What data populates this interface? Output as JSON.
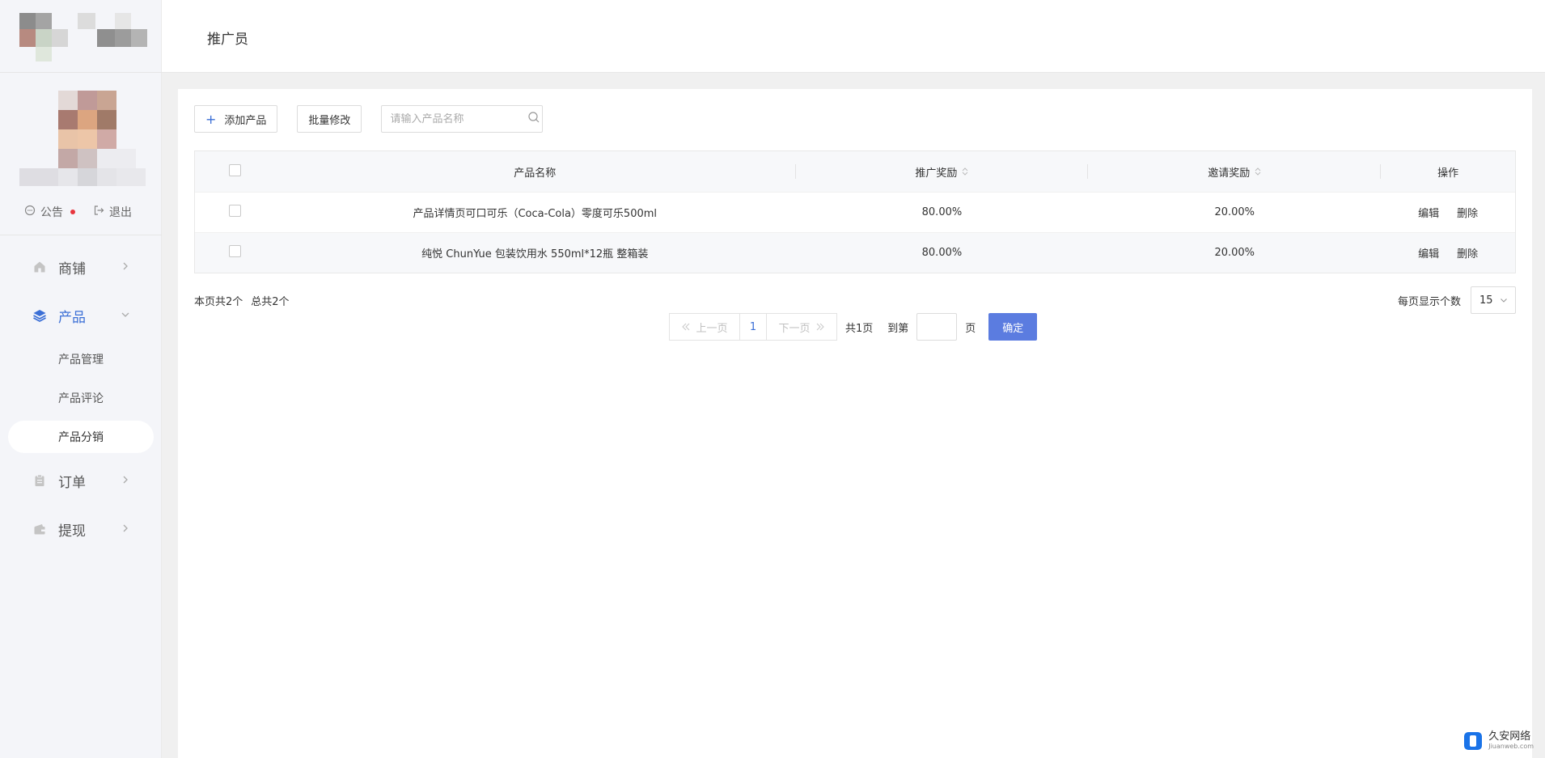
{
  "header": {
    "title": "推广员"
  },
  "sidebar": {
    "quick_links": [
      {
        "label": "公告",
        "icon": "chat-icon",
        "has_dot": true
      },
      {
        "label": "退出",
        "icon": "logout-icon"
      }
    ],
    "nav": [
      {
        "label": "商铺",
        "icon": "home-icon"
      },
      {
        "label": "产品",
        "icon": "layers-icon",
        "active": true
      },
      {
        "label": "订单",
        "icon": "clipboard-icon"
      },
      {
        "label": "提现",
        "icon": "wallet-icon"
      }
    ],
    "product_sub": [
      "产品管理",
      "产品评论",
      "产品分销"
    ],
    "selected_sub": "产品分销"
  },
  "toolbar": {
    "add_label": "添加产品",
    "batch_label": "批量修改",
    "search_placeholder": "请输入产品名称"
  },
  "table": {
    "columns": [
      "产品名称",
      "推广奖励",
      "邀请奖励",
      "操作"
    ],
    "rows": [
      {
        "name": "产品详情页可口可乐（Coca-Cola）零度可乐500ml",
        "promo": "80.00%",
        "invite": "20.00%",
        "edit": "编辑",
        "delete": "删除"
      },
      {
        "name": "纯悦 ChunYue 包装饮用水 550ml*12瓶 整箱装",
        "promo": "80.00%",
        "invite": "20.00%",
        "edit": "编辑",
        "delete": "删除"
      }
    ]
  },
  "summary": {
    "page_count": "本页共2个",
    "total_count": "总共2个"
  },
  "pagination": {
    "prev": "上一页",
    "current": "1",
    "next": "下一页",
    "total_pages": "共1页",
    "goto_label": "到第",
    "page_unit": "页",
    "confirm": "确定",
    "per_page_label": "每页显示个数",
    "per_page_value": "15"
  },
  "watermark": {
    "main": "久安网络",
    "sub": "Jiuanweb.com"
  },
  "colors": {
    "accent": "#3b6fd6",
    "confirm_bg": "#5b7ce0",
    "dot": "#e8353d"
  }
}
